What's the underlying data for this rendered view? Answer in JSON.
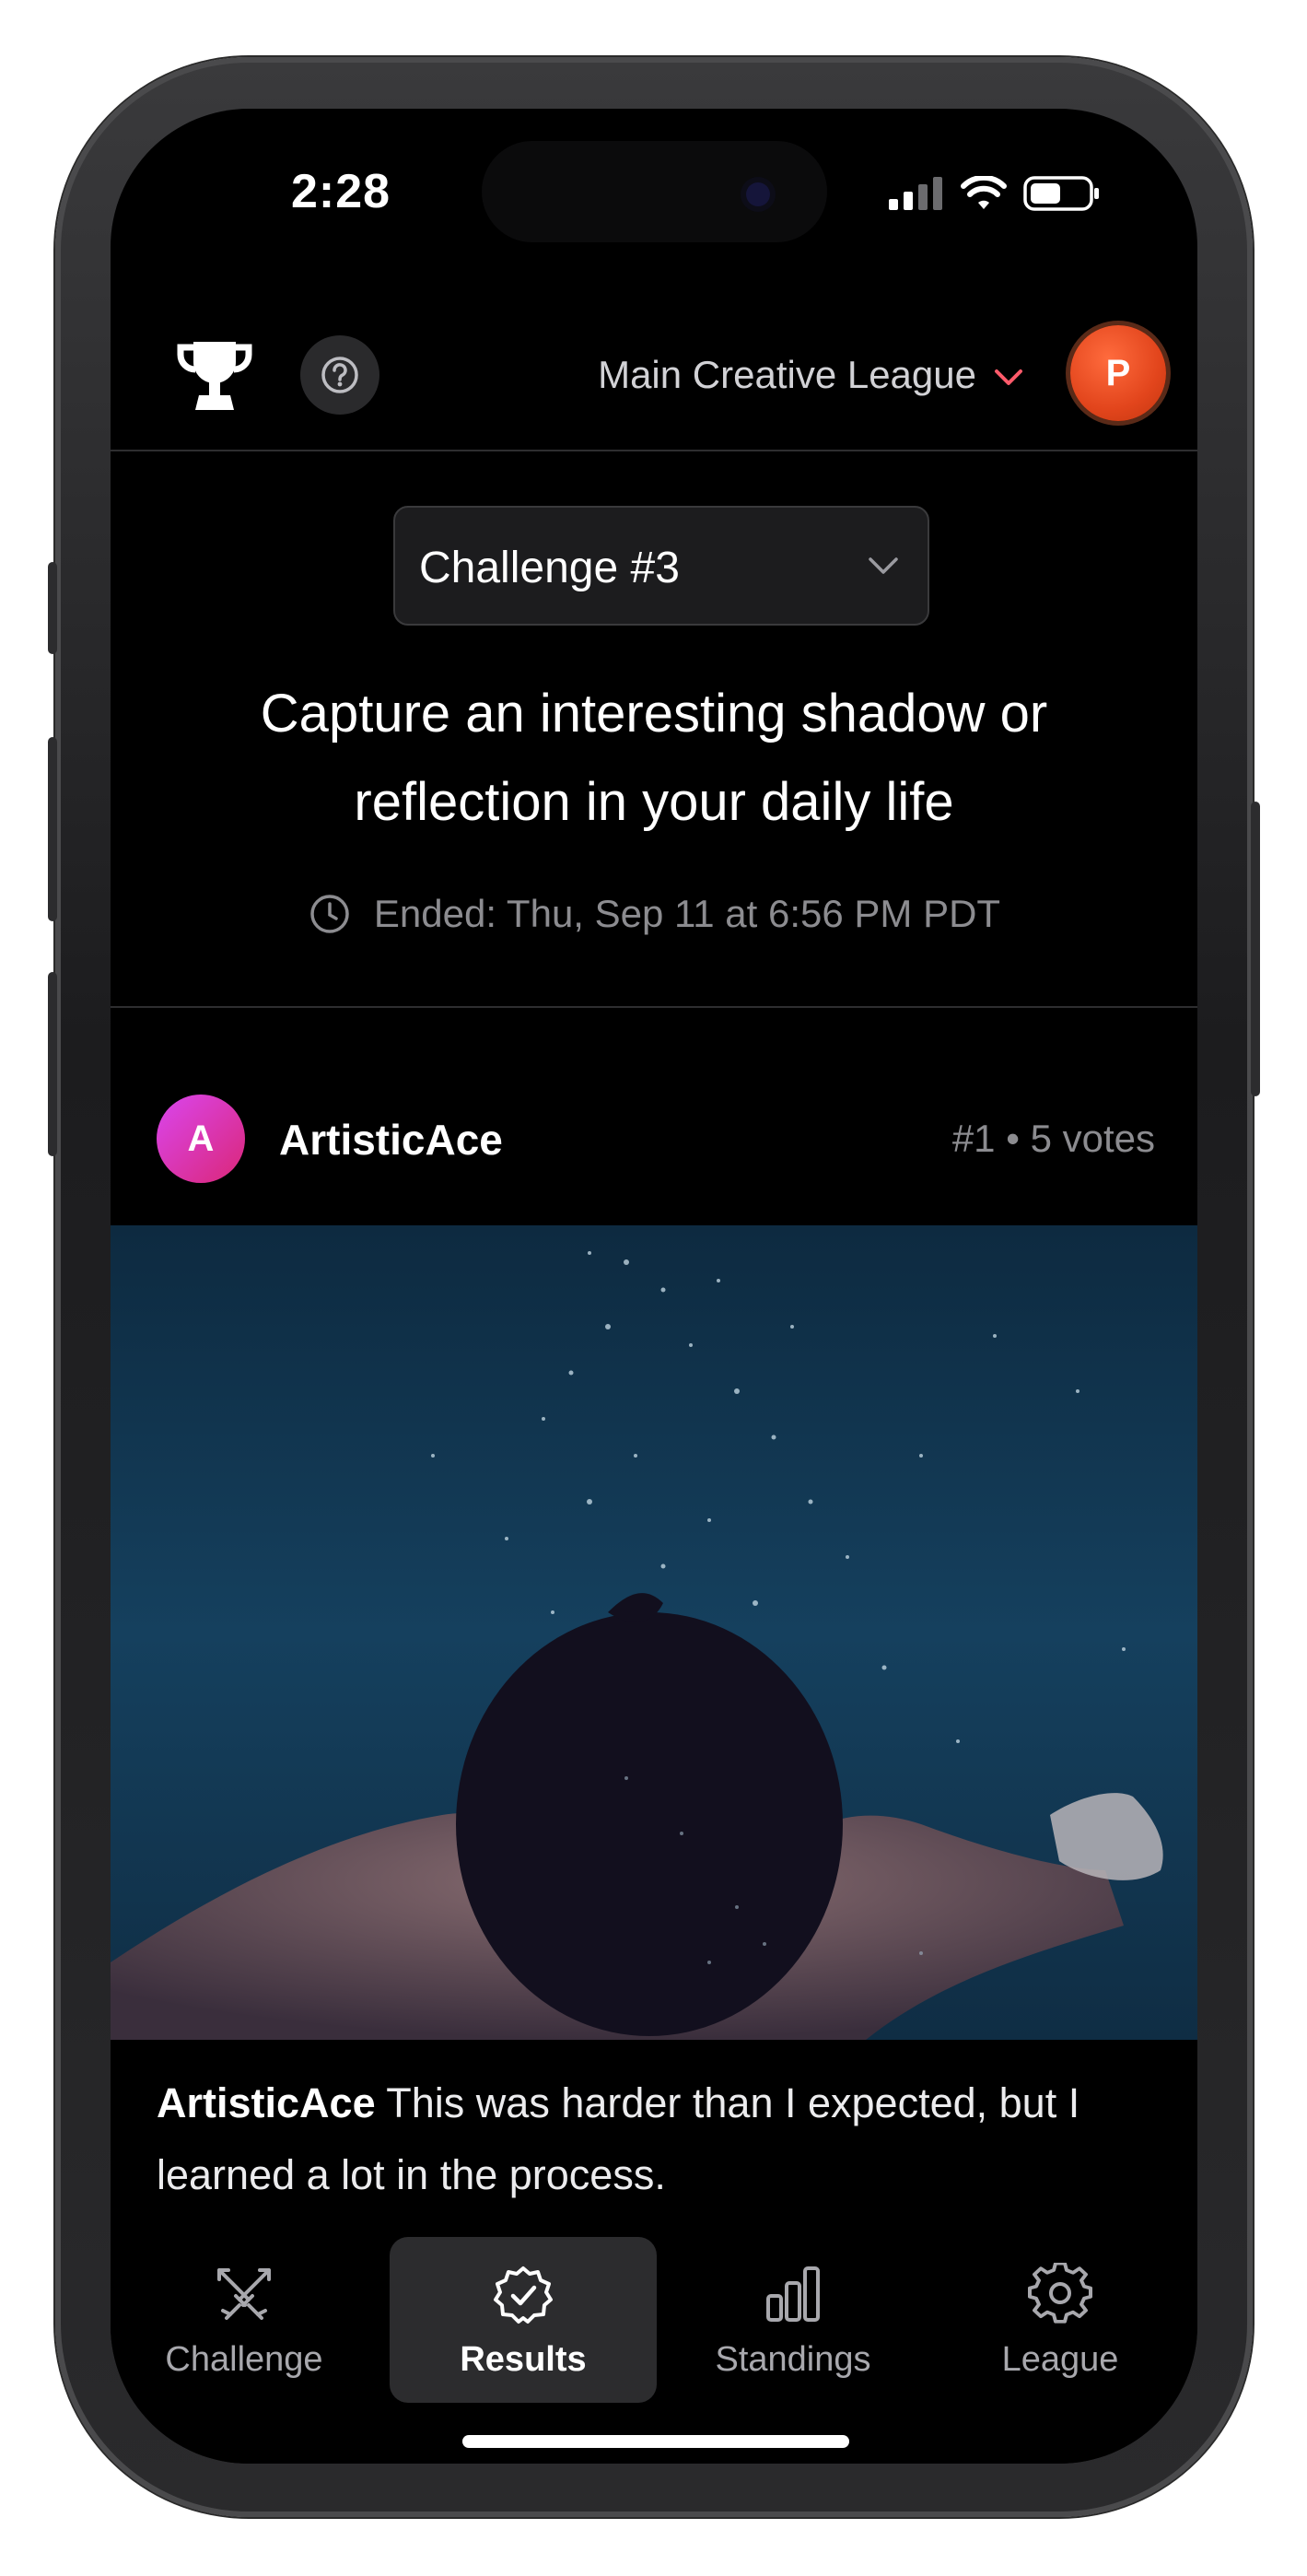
{
  "status_bar": {
    "time": "2:28"
  },
  "header": {
    "league_name": "Main Creative League",
    "avatar_initial": "P",
    "icons": [
      "trophy-icon",
      "help-icon",
      "chevron-down-icon"
    ]
  },
  "challenge": {
    "selected": "Challenge #3",
    "prompt": "Capture an interesting shadow or reflection in your daily life",
    "ended": "Ended: Thu, Sep 11 at 6:56 PM PDT"
  },
  "post": {
    "author_initial": "A",
    "author": "ArtisticAce",
    "rank_votes": "#1 • 5 votes",
    "caption_author": "ArtisticAce",
    "caption_text": " This was harder than I expected, but I learned a lot in the process."
  },
  "tabs": [
    {
      "label": "Challenge",
      "icon": "swords-icon",
      "active": false
    },
    {
      "label": "Results",
      "icon": "check-badge-icon",
      "active": true
    },
    {
      "label": "Standings",
      "icon": "bar-chart-icon",
      "active": false
    },
    {
      "label": "League",
      "icon": "gear-icon",
      "active": false
    }
  ],
  "colors": {
    "background": "#000000",
    "accent_avatar_p": "#e2451c",
    "accent_avatar_a": "#d946ef",
    "chevron_accent": "#ff5a6a",
    "active_tab_bg": "#2c2c2e"
  }
}
